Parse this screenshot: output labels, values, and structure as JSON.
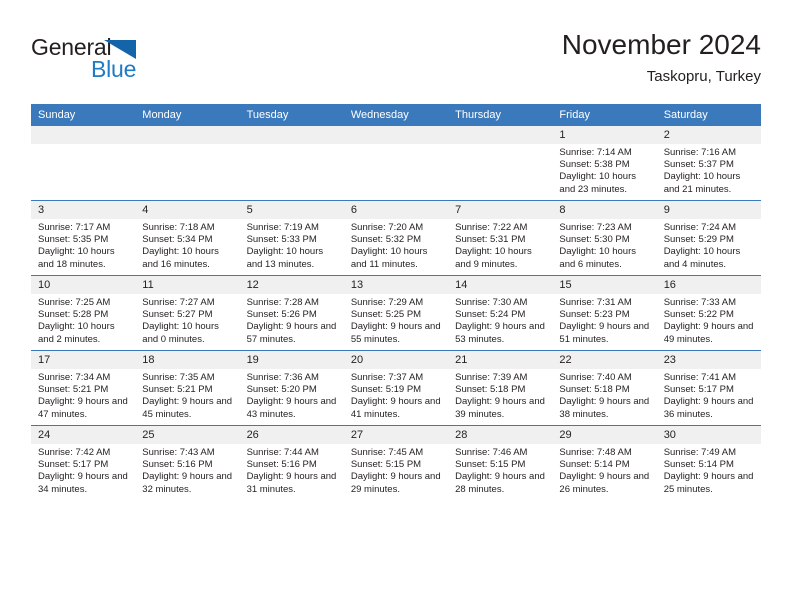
{
  "logo": {
    "word_one": "General",
    "word_two": "Blue",
    "triangle_color": "#1464aa",
    "blue_color": "#1f7bc4"
  },
  "header": {
    "title": "November 2024",
    "subtitle": "Taskopru, Turkey"
  },
  "theme": {
    "header_blue": "#3b79bd",
    "daynum_gray": "#f0f0f0",
    "text": "#231f20"
  },
  "calendar": {
    "weekday_headers": [
      "Sunday",
      "Monday",
      "Tuesday",
      "Wednesday",
      "Thursday",
      "Friday",
      "Saturday"
    ],
    "labels": {
      "sunrise": "Sunrise:",
      "sunset": "Sunset:",
      "daylight": "Daylight:"
    },
    "weeks": [
      [
        {
          "day": "",
          "empty": true
        },
        {
          "day": "",
          "empty": true
        },
        {
          "day": "",
          "empty": true
        },
        {
          "day": "",
          "empty": true
        },
        {
          "day": "",
          "empty": true
        },
        {
          "day": "1",
          "sunrise": "Sunrise: 7:14 AM",
          "sunset": "Sunset: 5:38 PM",
          "daylight": "Daylight: 10 hours and 23 minutes."
        },
        {
          "day": "2",
          "sunrise": "Sunrise: 7:16 AM",
          "sunset": "Sunset: 5:37 PM",
          "daylight": "Daylight: 10 hours and 21 minutes."
        }
      ],
      [
        {
          "day": "3",
          "sunrise": "Sunrise: 7:17 AM",
          "sunset": "Sunset: 5:35 PM",
          "daylight": "Daylight: 10 hours and 18 minutes."
        },
        {
          "day": "4",
          "sunrise": "Sunrise: 7:18 AM",
          "sunset": "Sunset: 5:34 PM",
          "daylight": "Daylight: 10 hours and 16 minutes."
        },
        {
          "day": "5",
          "sunrise": "Sunrise: 7:19 AM",
          "sunset": "Sunset: 5:33 PM",
          "daylight": "Daylight: 10 hours and 13 minutes."
        },
        {
          "day": "6",
          "sunrise": "Sunrise: 7:20 AM",
          "sunset": "Sunset: 5:32 PM",
          "daylight": "Daylight: 10 hours and 11 minutes."
        },
        {
          "day": "7",
          "sunrise": "Sunrise: 7:22 AM",
          "sunset": "Sunset: 5:31 PM",
          "daylight": "Daylight: 10 hours and 9 minutes."
        },
        {
          "day": "8",
          "sunrise": "Sunrise: 7:23 AM",
          "sunset": "Sunset: 5:30 PM",
          "daylight": "Daylight: 10 hours and 6 minutes."
        },
        {
          "day": "9",
          "sunrise": "Sunrise: 7:24 AM",
          "sunset": "Sunset: 5:29 PM",
          "daylight": "Daylight: 10 hours and 4 minutes."
        }
      ],
      [
        {
          "day": "10",
          "sunrise": "Sunrise: 7:25 AM",
          "sunset": "Sunset: 5:28 PM",
          "daylight": "Daylight: 10 hours and 2 minutes."
        },
        {
          "day": "11",
          "sunrise": "Sunrise: 7:27 AM",
          "sunset": "Sunset: 5:27 PM",
          "daylight": "Daylight: 10 hours and 0 minutes."
        },
        {
          "day": "12",
          "sunrise": "Sunrise: 7:28 AM",
          "sunset": "Sunset: 5:26 PM",
          "daylight": "Daylight: 9 hours and 57 minutes."
        },
        {
          "day": "13",
          "sunrise": "Sunrise: 7:29 AM",
          "sunset": "Sunset: 5:25 PM",
          "daylight": "Daylight: 9 hours and 55 minutes."
        },
        {
          "day": "14",
          "sunrise": "Sunrise: 7:30 AM",
          "sunset": "Sunset: 5:24 PM",
          "daylight": "Daylight: 9 hours and 53 minutes."
        },
        {
          "day": "15",
          "sunrise": "Sunrise: 7:31 AM",
          "sunset": "Sunset: 5:23 PM",
          "daylight": "Daylight: 9 hours and 51 minutes."
        },
        {
          "day": "16",
          "sunrise": "Sunrise: 7:33 AM",
          "sunset": "Sunset: 5:22 PM",
          "daylight": "Daylight: 9 hours and 49 minutes."
        }
      ],
      [
        {
          "day": "17",
          "sunrise": "Sunrise: 7:34 AM",
          "sunset": "Sunset: 5:21 PM",
          "daylight": "Daylight: 9 hours and 47 minutes."
        },
        {
          "day": "18",
          "sunrise": "Sunrise: 7:35 AM",
          "sunset": "Sunset: 5:21 PM",
          "daylight": "Daylight: 9 hours and 45 minutes."
        },
        {
          "day": "19",
          "sunrise": "Sunrise: 7:36 AM",
          "sunset": "Sunset: 5:20 PM",
          "daylight": "Daylight: 9 hours and 43 minutes."
        },
        {
          "day": "20",
          "sunrise": "Sunrise: 7:37 AM",
          "sunset": "Sunset: 5:19 PM",
          "daylight": "Daylight: 9 hours and 41 minutes."
        },
        {
          "day": "21",
          "sunrise": "Sunrise: 7:39 AM",
          "sunset": "Sunset: 5:18 PM",
          "daylight": "Daylight: 9 hours and 39 minutes."
        },
        {
          "day": "22",
          "sunrise": "Sunrise: 7:40 AM",
          "sunset": "Sunset: 5:18 PM",
          "daylight": "Daylight: 9 hours and 38 minutes."
        },
        {
          "day": "23",
          "sunrise": "Sunrise: 7:41 AM",
          "sunset": "Sunset: 5:17 PM",
          "daylight": "Daylight: 9 hours and 36 minutes."
        }
      ],
      [
        {
          "day": "24",
          "sunrise": "Sunrise: 7:42 AM",
          "sunset": "Sunset: 5:17 PM",
          "daylight": "Daylight: 9 hours and 34 minutes."
        },
        {
          "day": "25",
          "sunrise": "Sunrise: 7:43 AM",
          "sunset": "Sunset: 5:16 PM",
          "daylight": "Daylight: 9 hours and 32 minutes."
        },
        {
          "day": "26",
          "sunrise": "Sunrise: 7:44 AM",
          "sunset": "Sunset: 5:16 PM",
          "daylight": "Daylight: 9 hours and 31 minutes."
        },
        {
          "day": "27",
          "sunrise": "Sunrise: 7:45 AM",
          "sunset": "Sunset: 5:15 PM",
          "daylight": "Daylight: 9 hours and 29 minutes."
        },
        {
          "day": "28",
          "sunrise": "Sunrise: 7:46 AM",
          "sunset": "Sunset: 5:15 PM",
          "daylight": "Daylight: 9 hours and 28 minutes."
        },
        {
          "day": "29",
          "sunrise": "Sunrise: 7:48 AM",
          "sunset": "Sunset: 5:14 PM",
          "daylight": "Daylight: 9 hours and 26 minutes."
        },
        {
          "day": "30",
          "sunrise": "Sunrise: 7:49 AM",
          "sunset": "Sunset: 5:14 PM",
          "daylight": "Daylight: 9 hours and 25 minutes."
        }
      ]
    ]
  }
}
